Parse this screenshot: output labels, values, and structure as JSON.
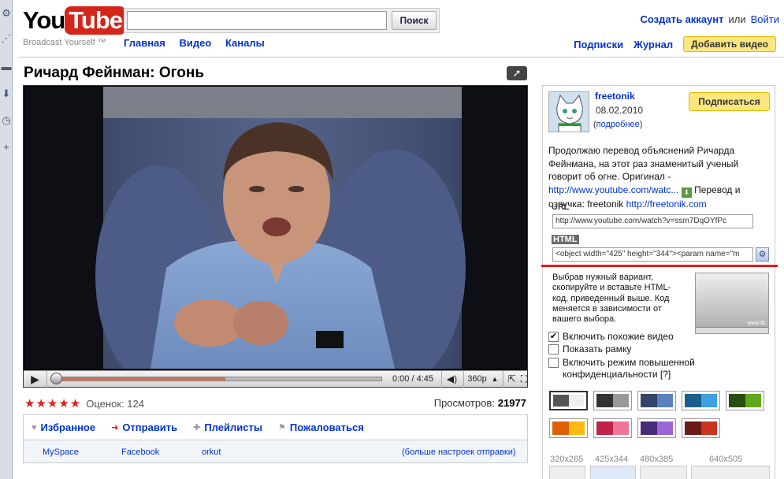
{
  "header": {
    "logo_you": "You",
    "logo_tube": "Tube",
    "tagline": "Broadcast Yourself ™",
    "search_placeholder": "",
    "search_button": "Поиск",
    "create_account": "Создать аккаунт",
    "or": "или",
    "login": "Войти",
    "nav": [
      "Главная",
      "Видео",
      "Каналы"
    ],
    "subscriptions": "Подписки",
    "history": "Журнал",
    "upload": "Добавить видео"
  },
  "video": {
    "title": "Ричард Фейнман: Огонь",
    "time": "0:00 / 4:45",
    "quality": "360p",
    "progress_buffered": 0.52,
    "rating_label": "Оценок: 124",
    "stars": 5,
    "views_label": "Просмотров:",
    "views_count": "21977"
  },
  "actions": [
    {
      "label": "Избранное",
      "icon": "heart-icon"
    },
    {
      "label": "Отправить",
      "icon": "arrow-icon"
    },
    {
      "label": "Плейлисты",
      "icon": "plus-icon"
    },
    {
      "label": "Пожаловаться",
      "icon": "flag-icon"
    }
  ],
  "share": {
    "links": [
      "MySpace",
      "Facebook",
      "orkut"
    ],
    "more": "(больше настроек отправки)"
  },
  "uploader": {
    "name": "freetonik",
    "date": "08.02.2010",
    "more": "подробнее",
    "subscribe": "Подписаться"
  },
  "description": {
    "text1": "Продолжаю перевод объяснений Ричарда Фейнмана, на этот раз знаменитый ученый говорит об огне. Оригинал - ",
    "link1": "http://www.youtube.com/watc...",
    "text2": " Перевод и озвучка: freetonik ",
    "link2": "http://freetonik.com"
  },
  "embed": {
    "url_label": "URL",
    "url_value": "http://www.youtube.com/watch?v=ssm7DqOYfPc",
    "html_label": "HTML",
    "html_value": "<object width=\"425\" height=\"344\"><param name=\"m",
    "hint": "Выбрав нужный вариант, скопируйте и вставьте HTML-код, приведенный выше. Код меняется в зависимости от вашего выбора.",
    "preview_mark": "www.tb",
    "opt_related": "Включить похожие видео",
    "opt_border": "Показать рамку",
    "opt_privacy": "Включить режим повышенной конфиденциальности [?]",
    "opt_related_checked": true,
    "opt_border_checked": false,
    "opt_privacy_checked": false
  },
  "swatches": [
    [
      "#555555",
      "#eeeeee"
    ],
    [
      "#333333",
      "#999999"
    ],
    [
      "#334466",
      "#5b7fbf"
    ],
    [
      "#1a5e8c",
      "#3fa0e0"
    ],
    [
      "#2b4d12",
      "#5fa81e"
    ],
    [
      "#e0600a",
      "#ffbb11"
    ],
    [
      "#c0224a",
      "#ee7799"
    ],
    [
      "#4a2a7a",
      "#9a66d6"
    ],
    [
      "#6a1818",
      "#cc3322"
    ]
  ],
  "sizes": [
    "320x265",
    "425x344",
    "480x385",
    "640x505"
  ]
}
